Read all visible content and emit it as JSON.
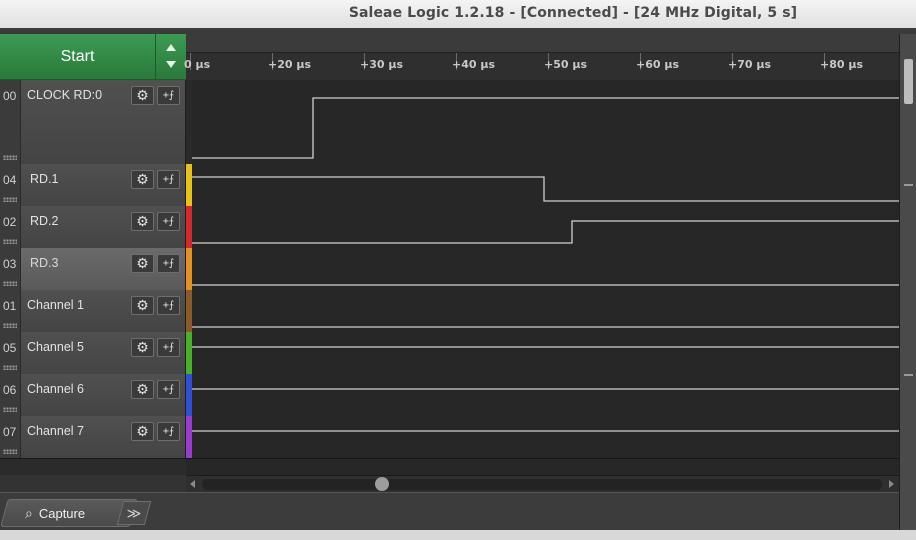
{
  "window": {
    "title": "Saleae Logic 1.2.18 - [Connected] - [24 MHz Digital, 5 s]"
  },
  "controls": {
    "start_label": "Start"
  },
  "ruler": {
    "ticks": [
      "0 µs",
      "+20 µs",
      "+30 µs",
      "+40 µs",
      "+50 µs",
      "+60 µs",
      "+70 µs",
      "+80 µs"
    ]
  },
  "channels": [
    {
      "num": "00",
      "name": "CLOCK RD:0",
      "color": "#2a2a2a"
    },
    {
      "num": "04",
      "name": "RD.1",
      "color": "#e8c21a"
    },
    {
      "num": "02",
      "name": "RD.2",
      "color": "#d12a2a"
    },
    {
      "num": "03",
      "name": "RD.3",
      "color": "#e39120",
      "selected": true
    },
    {
      "num": "01",
      "name": "Channel 1",
      "color": "#8a5a2b"
    },
    {
      "num": "05",
      "name": "Channel 5",
      "color": "#4caf2a"
    },
    {
      "num": "06",
      "name": "Channel 6",
      "color": "#2f4fd6"
    },
    {
      "num": "07",
      "name": "Channel 7",
      "color": "#9a3bd0"
    }
  ],
  "icons": {
    "gear": "gear-icon",
    "trigger": "trigger-icon",
    "search": "search-icon",
    "more": "double-chevron-icon"
  },
  "bottom": {
    "capture_label": "Capture",
    "more_label": "≫"
  }
}
